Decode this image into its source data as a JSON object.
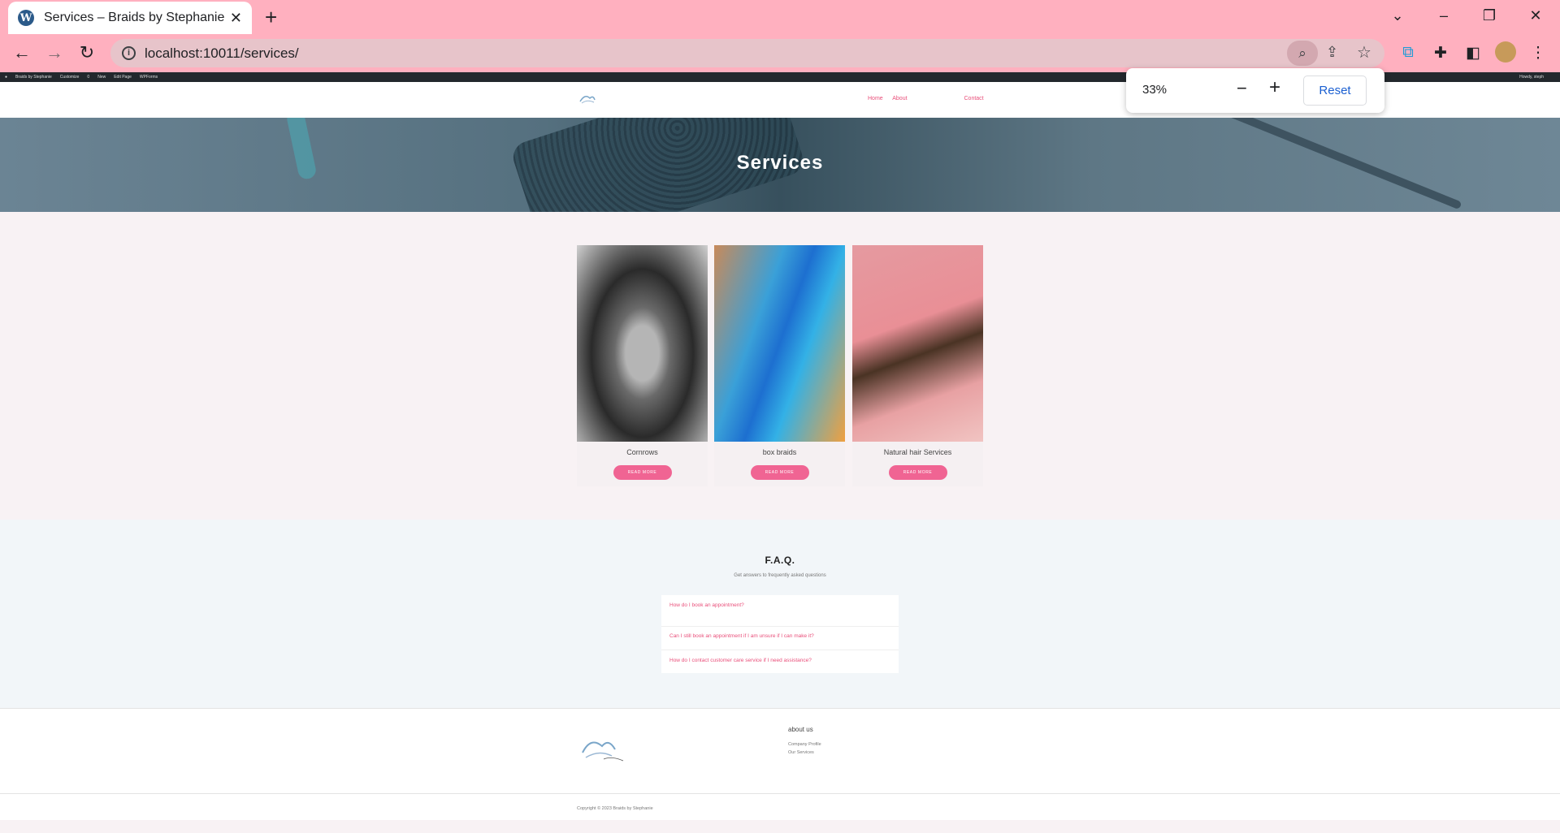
{
  "browser": {
    "tab_title": "Services – Braids by Stephanie",
    "tab_icon": "wordpress-icon",
    "url": "localhost:10011/services/",
    "zoom_popup": {
      "level": "33%",
      "reset_label": "Reset"
    }
  },
  "admin_bar": {
    "items": [
      "Braids by Stephanie",
      "Customize",
      "0",
      "New",
      "Edit Page",
      "WPForms"
    ],
    "greeting": "Howdy, steph"
  },
  "header": {
    "nav": {
      "home": "Home",
      "about": "About",
      "contact": "Contact"
    }
  },
  "hero": {
    "title": "Services"
  },
  "services": [
    {
      "name": "Cornrows",
      "button": "READ MORE"
    },
    {
      "name": "box braids",
      "button": "READ MORE"
    },
    {
      "name": "Natural hair Services",
      "button": "READ MORE"
    }
  ],
  "faq": {
    "title": "F.A.Q.",
    "subtitle": "Get answers to frequently asked questions",
    "questions": [
      "How do I book an appointment?",
      "Can I still book an appointment if I am unsure if I can make it?",
      "How do I contact customer care service if I need assistance?"
    ]
  },
  "footer": {
    "heading": "about us",
    "links": [
      "Company Profile",
      "Our Services"
    ],
    "copyright": "Copyright © 2023 Braids by Stephanie"
  },
  "colors": {
    "accent": "#f06493",
    "tabbar": "#ffb0bf",
    "link": "#e94f7a"
  }
}
